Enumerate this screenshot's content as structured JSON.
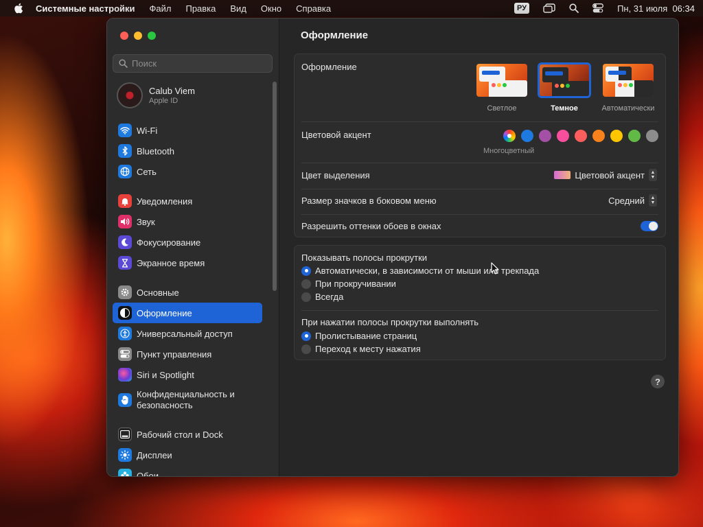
{
  "menubar": {
    "app_name": "Системные настройки",
    "menus": [
      "Файл",
      "Правка",
      "Вид",
      "Окно",
      "Справка"
    ],
    "input_source": "РУ",
    "datetime": "Пн, 31 июля  06:34"
  },
  "sidebar": {
    "search_placeholder": "Поиск",
    "profile": {
      "name": "Calub Viem",
      "subtitle": "Apple ID"
    },
    "items": [
      {
        "label": "Wi-Fi",
        "icon": "wifi-icon",
        "color": "#1f7ae0"
      },
      {
        "label": "Bluetooth",
        "icon": "bluetooth-icon",
        "color": "#1f7ae0"
      },
      {
        "label": "Сеть",
        "icon": "network-globe-icon",
        "color": "#1f7ae0"
      },
      {
        "label": "Уведомления",
        "icon": "bell-icon",
        "color": "#e8403a"
      },
      {
        "label": "Звук",
        "icon": "speaker-icon",
        "color": "#e0306a"
      },
      {
        "label": "Фокусирование",
        "icon": "moon-icon",
        "color": "#5a4ad6"
      },
      {
        "label": "Экранное время",
        "icon": "hourglass-icon",
        "color": "#5a4ad6"
      },
      {
        "label": "Основные",
        "icon": "gear-icon",
        "color": "#8a8a8a"
      },
      {
        "label": "Оформление",
        "icon": "appearance-icon",
        "color": "#111111"
      },
      {
        "label": "Универсальный доступ",
        "icon": "accessibility-icon",
        "color": "#1f7ae0"
      },
      {
        "label": "Пункт управления",
        "icon": "control-center-icon",
        "color": "#8a8a8a"
      },
      {
        "label": "Siri и Spotlight",
        "icon": "siri-icon",
        "color": "#6a3ad6"
      },
      {
        "label": "Конфиденциальность и безопасность",
        "icon": "hand-icon",
        "color": "#1f7ae0"
      },
      {
        "label": "Рабочий стол и Dock",
        "icon": "dock-icon",
        "color": "#222222"
      },
      {
        "label": "Дисплеи",
        "icon": "sun-icon",
        "color": "#1f7ae0"
      },
      {
        "label": "Обои",
        "icon": "wallpaper-icon",
        "color": "#2ab0e0"
      }
    ],
    "selected": "Оформление"
  },
  "main": {
    "title": "Оформление",
    "appearance": {
      "label": "Оформление",
      "options": [
        {
          "name": "Светлое"
        },
        {
          "name": "Темное"
        },
        {
          "name": "Автоматически"
        }
      ],
      "selected": "Темное"
    },
    "accent": {
      "label": "Цветовой акцент",
      "colors": [
        "#1f7ae0",
        "#a550a7",
        "#f74f9e",
        "#fc5e5e",
        "#f7821b",
        "#ffc600",
        "#62ba46",
        "#8c8c8c"
      ],
      "selected_caption": "Многоцветный"
    },
    "highlight": {
      "label": "Цвет выделения",
      "value": "Цветовой акцент"
    },
    "sidebar_icon_size": {
      "label": "Размер значков в боковом меню",
      "value": "Средний"
    },
    "wallpaper_tinting": {
      "label": "Разрешить оттенки обоев в окнах",
      "enabled": true
    },
    "show_scrollbars": {
      "label": "Показывать полосы прокрутки",
      "options": [
        "Автоматически, в зависимости от мыши или трекпада",
        "При прокручивании",
        "Всегда"
      ],
      "selected": 0
    },
    "click_scrollbar": {
      "label": "При нажатии полосы прокрутки выполнять",
      "options": [
        "Пролистывание страниц",
        "Переход к месту нажатия"
      ],
      "selected": 0
    },
    "help": "?"
  }
}
